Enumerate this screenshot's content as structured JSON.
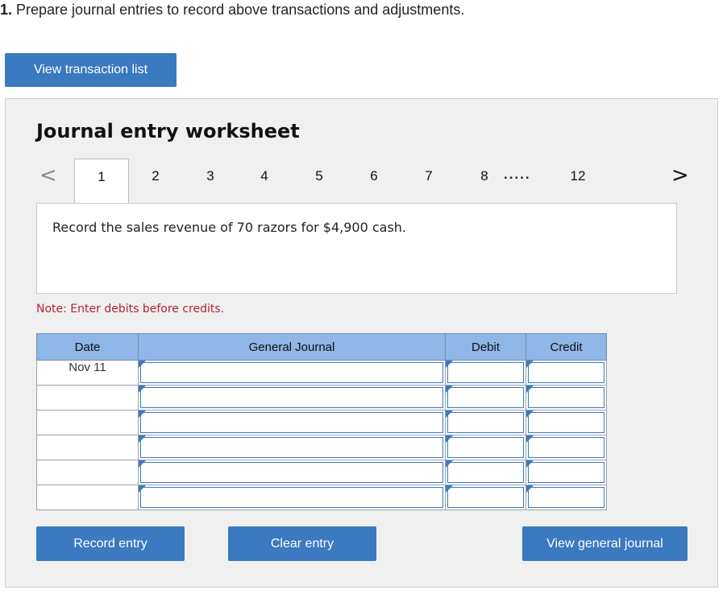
{
  "question": {
    "number": "1.",
    "text": " Prepare journal entries to record above transactions and adjustments."
  },
  "buttons": {
    "view_transaction_list": "View transaction list",
    "record_entry": "Record entry",
    "clear_entry": "Clear entry",
    "view_general_journal": "View general journal"
  },
  "worksheet": {
    "title": "Journal entry worksheet",
    "pager": {
      "prev": "<",
      "next": ">",
      "pages": [
        "1",
        "2",
        "3",
        "4",
        "5",
        "6",
        "7",
        "8"
      ],
      "ellipsis": ".....",
      "last": "12",
      "active": "1"
    },
    "description": "Record the sales revenue of 70 razors for $4,900 cash.",
    "note": "Note: Enter debits before credits.",
    "table": {
      "headers": {
        "date": "Date",
        "general_journal": "General Journal",
        "debit": "Debit",
        "credit": "Credit"
      },
      "rows": [
        {
          "date": "Nov 11"
        },
        {
          "date": ""
        },
        {
          "date": ""
        },
        {
          "date": ""
        },
        {
          "date": ""
        },
        {
          "date": ""
        }
      ]
    }
  },
  "colors": {
    "accent": "#3b79c0",
    "header_bg": "#8eb6e6",
    "note": "#b0242a"
  }
}
